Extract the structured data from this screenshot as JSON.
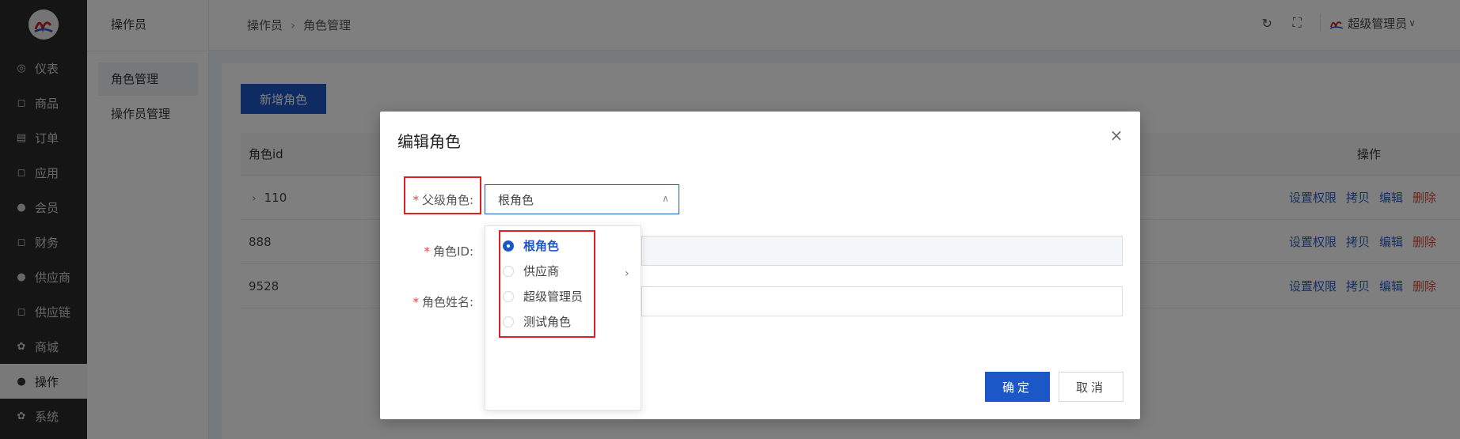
{
  "sidebar": {
    "items": [
      {
        "label": "仪表",
        "icon": "dashboard-icon",
        "glyph": "◎"
      },
      {
        "label": "商品",
        "icon": "bag-icon",
        "glyph": "◻"
      },
      {
        "label": "订单",
        "icon": "clipboard-icon",
        "glyph": "▤"
      },
      {
        "label": "应用",
        "icon": "bag-icon",
        "glyph": "◻"
      },
      {
        "label": "会员",
        "icon": "user-icon",
        "glyph": "●"
      },
      {
        "label": "财务",
        "icon": "bag-icon",
        "glyph": "◻"
      },
      {
        "label": "供应商",
        "icon": "user-icon",
        "glyph": "●"
      },
      {
        "label": "供应链",
        "icon": "bag-icon",
        "glyph": "◻"
      },
      {
        "label": "商城",
        "icon": "gear-icon",
        "glyph": "✿"
      },
      {
        "label": "操作",
        "icon": "user-icon",
        "glyph": "●",
        "active": true
      },
      {
        "label": "系统",
        "icon": "gear-icon",
        "glyph": "✿"
      }
    ]
  },
  "submenu": {
    "title": "操作员",
    "items": [
      {
        "label": "角色管理",
        "active": true
      },
      {
        "label": "操作员管理"
      }
    ]
  },
  "header": {
    "breadcrumb": [
      "操作员",
      "角色管理"
    ],
    "user_name": "超级管理员"
  },
  "content": {
    "add_button": "新增角色",
    "columns": {
      "id": "角色id",
      "ops": "操作"
    },
    "rows": [
      {
        "id": "110",
        "expandable": true
      },
      {
        "id": "888"
      },
      {
        "id": "9528"
      }
    ],
    "row_actions": [
      "设置权限",
      "拷贝",
      "编辑",
      "删除"
    ]
  },
  "modal": {
    "title": "编辑角色",
    "fields": {
      "parent_label": "父级角色:",
      "id_label": "角色ID:",
      "name_label": "角色姓名:"
    },
    "parent_value": "根角色",
    "options": [
      {
        "label": "根角色",
        "checked": true
      },
      {
        "label": "供应商",
        "has_children": true
      },
      {
        "label": "超级管理员"
      },
      {
        "label": "测试角色"
      }
    ],
    "ok_label": "确定",
    "cancel_label": "取消"
  },
  "colors": {
    "accent": "#1c57c7",
    "danger": "#e0453d",
    "highlight": "#e02020",
    "sidebar_bg": "#2b2b2b"
  }
}
